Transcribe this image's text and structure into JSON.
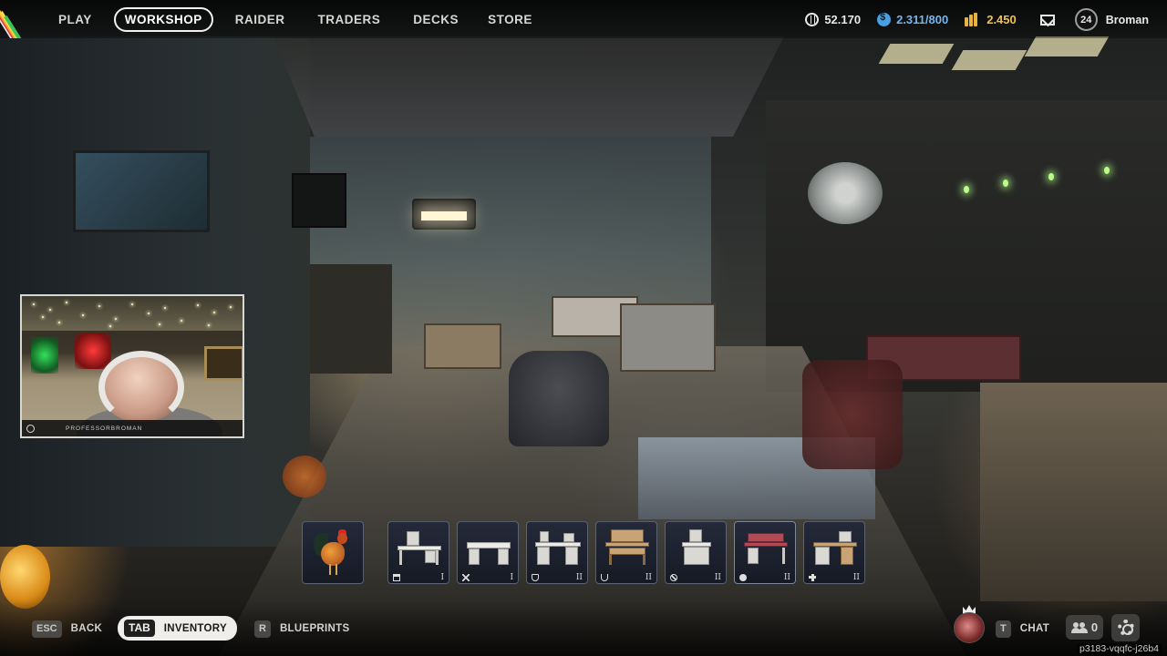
{
  "nav": {
    "items": [
      {
        "label": "PLAY",
        "active": false
      },
      {
        "label": "WORKSHOP",
        "active": true
      },
      {
        "label": "RAIDER",
        "active": false
      },
      {
        "label": "TRADERS",
        "active": false
      },
      {
        "label": "DECKS",
        "active": false
      },
      {
        "label": "STORE",
        "active": false
      }
    ]
  },
  "currencies": {
    "coins": {
      "icon": "coin-icon",
      "value": "52.170"
    },
    "credits": {
      "icon": "credit-icon",
      "value": "2.311/800",
      "color": "#74b6ec"
    },
    "gold": {
      "icon": "gold-bars-icon",
      "value": "2.450",
      "color": "#f1c24e"
    }
  },
  "profile": {
    "level": "24",
    "username": "Broman"
  },
  "webcam": {
    "handle": "PROFESSORBROMAN"
  },
  "slots": [
    {
      "name": "rooster",
      "icon": "",
      "tier": ""
    },
    {
      "name": "bench-1",
      "icon": "bench-icon",
      "tier": "I"
    },
    {
      "name": "bench-2",
      "icon": "swords-icon",
      "tier": "I"
    },
    {
      "name": "bench-3",
      "icon": "shield-icon",
      "tier": "II"
    },
    {
      "name": "bench-4",
      "icon": "flask-icon",
      "tier": "II"
    },
    {
      "name": "bench-5",
      "icon": "tools-icon",
      "tier": "II"
    },
    {
      "name": "bench-6",
      "icon": "bomb-icon",
      "tier": "II"
    },
    {
      "name": "bench-7",
      "icon": "medkit-icon",
      "tier": "II"
    }
  ],
  "bottom": {
    "back": {
      "key": "ESC",
      "label": "BACK"
    },
    "inventory": {
      "key": "TAB",
      "label": "INVENTORY"
    },
    "blueprints": {
      "key": "R",
      "label": "BLUEPRINTS"
    },
    "chat": {
      "key": "T",
      "label": "CHAT"
    },
    "friends_count": "0"
  },
  "session_id": "p3183-vqqfc-j26b4",
  "colors": {
    "accent": "#f0f0ee",
    "slot_bg": "#22283a"
  }
}
